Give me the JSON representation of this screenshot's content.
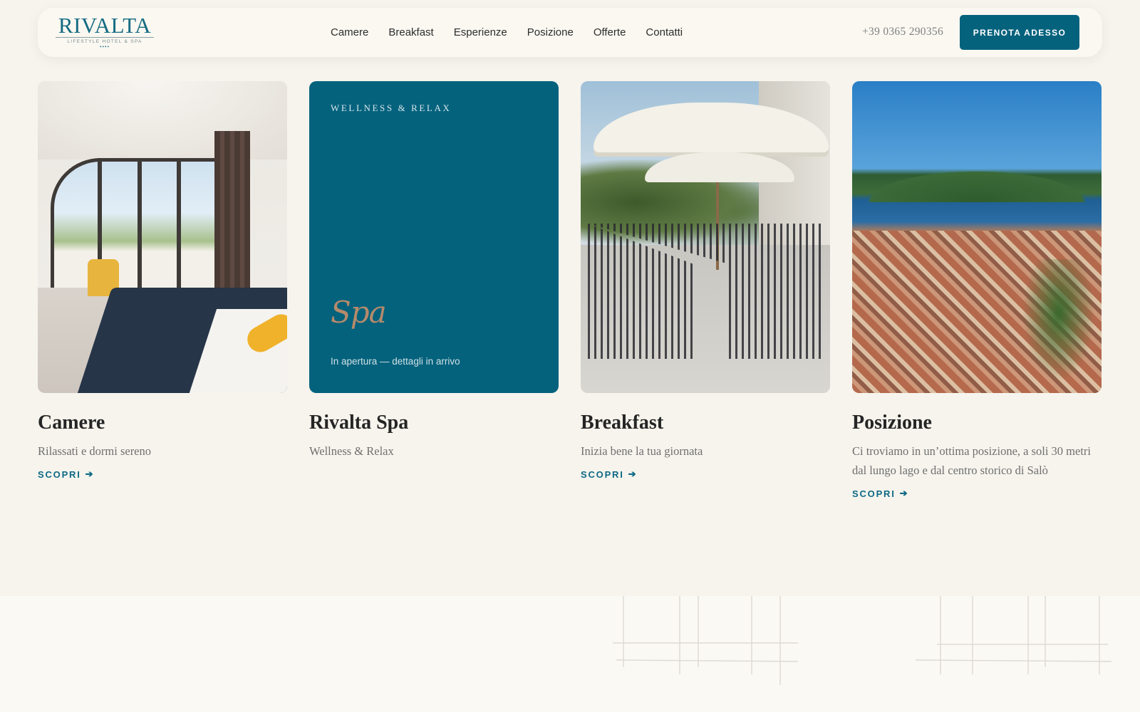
{
  "header": {
    "logo": {
      "wordmark": "RIVALTA",
      "tagline": "LIFESTYLE HOTEL & SPA",
      "stars": "••••"
    },
    "nav": [
      {
        "label": "Camere"
      },
      {
        "label": "Breakfast"
      },
      {
        "label": "Esperienze"
      },
      {
        "label": "Posizione"
      },
      {
        "label": "Offerte"
      },
      {
        "label": "Contatti"
      }
    ],
    "phone": "+39 0365 290356",
    "cta_label": "PRENOTA ADESSO"
  },
  "cards": [
    {
      "title": "Camere",
      "description": "Rilassati e dormi sereno",
      "link_label": "SCOPRI",
      "image": "hotel-room-photo"
    },
    {
      "title": "Rivalta Spa",
      "description": "Wellness & Relax",
      "eyebrow": "WELLNESS & RELAX",
      "script_label": "Spa",
      "note": "In apertura — dettagli in arrivo"
    },
    {
      "title": "Breakfast",
      "description": "Inizia bene la tua giornata",
      "link_label": "SCOPRI",
      "image": "terrace-breakfast-photo"
    },
    {
      "title": "Posizione",
      "description": "Ci troviamo in un’ottima posizione, a soli 30 metri dal lungo lago e dal centro storico di Salò",
      "link_label": "SCOPRI",
      "image": "lake-town-aerial-photo"
    }
  ],
  "icons": {
    "arrow": "arrow-right-icon"
  },
  "colors": {
    "accent": "#05627d",
    "background": "#f6f4ed",
    "spa_script": "#b58a6a"
  }
}
